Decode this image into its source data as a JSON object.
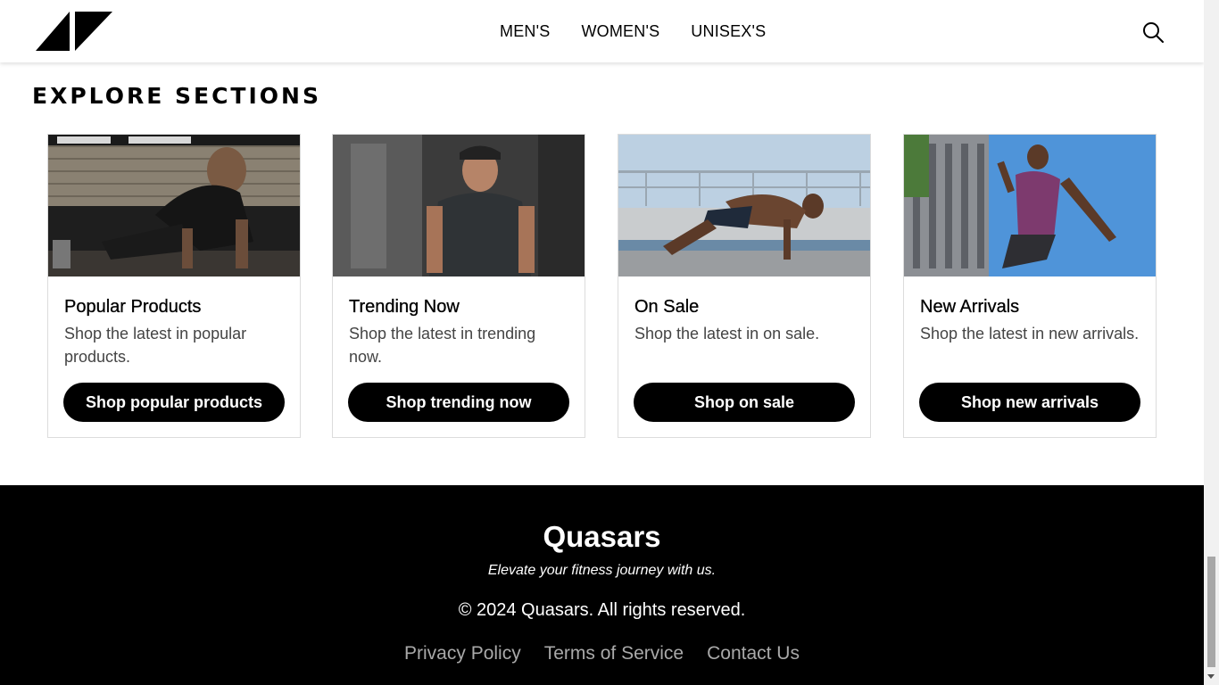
{
  "header": {
    "nav": [
      "MEN'S",
      "WOMEN'S",
      "UNISEX'S"
    ]
  },
  "section": {
    "title": "EXPLORE SECTIONS",
    "cards": [
      {
        "title": "Popular Products",
        "description": "Shop the latest in popular products.",
        "button": "Shop popular products",
        "image": "man-doing-pushups-photo"
      },
      {
        "title": "Trending Now",
        "description": "Shop the latest in trending now.",
        "button": "Shop trending now",
        "image": "man-in-cap-gym-photo"
      },
      {
        "title": "On Sale",
        "description": "Shop the latest in on sale.",
        "button": "Shop on sale",
        "image": "man-sprint-start-rooftop-photo"
      },
      {
        "title": "New Arrivals",
        "description": "Shop the latest in new arrivals.",
        "button": "Shop new arrivals",
        "image": "man-jumping-city-photo"
      }
    ]
  },
  "footer": {
    "brand": "Quasars",
    "tagline": "Elevate your fitness journey with us.",
    "copyright": "© 2024 Quasars. All rights reserved.",
    "links": [
      "Privacy Policy",
      "Terms of Service",
      "Contact Us"
    ]
  },
  "colors": {
    "primary": "#000000",
    "footer_link": "#a9a9a9",
    "card_border": "#dcdcdc"
  }
}
